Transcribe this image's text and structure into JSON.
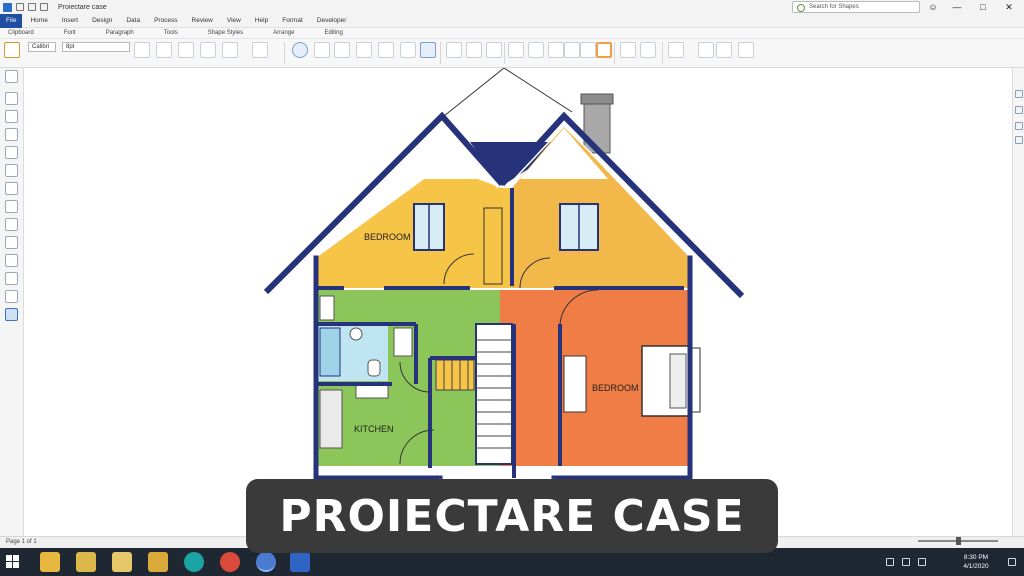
{
  "window": {
    "title": "Proiectare case",
    "search_placeholder": "Search for Shapes"
  },
  "menu": {
    "file": "File",
    "items": [
      "Home",
      "Insert",
      "Design",
      "Data",
      "Process",
      "Review",
      "View",
      "Help",
      "Format",
      "Developer"
    ]
  },
  "ribbon": {
    "groups": [
      "Clipboard",
      "Font",
      "Paragraph",
      "Tools",
      "Shape Styles",
      "Arrange",
      "Editing"
    ],
    "font_name": "Calibri",
    "font_size": "8pt"
  },
  "plan": {
    "rooms": {
      "bedroom_left_label": "BEDROOM",
      "bedroom_right_label": "BEDROOM",
      "kitchen_label": "KITCHEN"
    },
    "colors": {
      "yellow": "#f6c548",
      "orange_yellow": "#f3b84a",
      "green": "#8cc65a",
      "orange": "#f07d46",
      "blue": "#26337a",
      "bath": "#bfe5f3"
    }
  },
  "banner": {
    "text": "PROIECTARE CASE"
  },
  "status": {
    "page": "Page 1 of 1",
    "zoom_percent": 62
  },
  "taskbar": {
    "time": "8:30 PM",
    "date": "4/1/2020"
  }
}
